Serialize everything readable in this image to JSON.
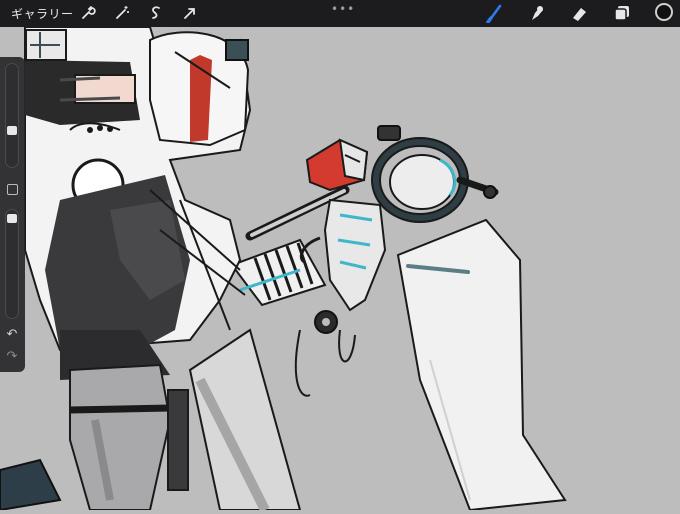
{
  "toolbar": {
    "gallery_label": "ギャラリー",
    "more_glyph": "•••",
    "active_color": "#111111",
    "accent_color": "#2f7bf0"
  },
  "sidebar": {
    "undo_glyph": "↶",
    "redo_glyph": "↷"
  },
  "canvas": {
    "background": "#bdbdbd",
    "accent_red": "#c0392b",
    "accent_teal": "#3fb7c9"
  }
}
